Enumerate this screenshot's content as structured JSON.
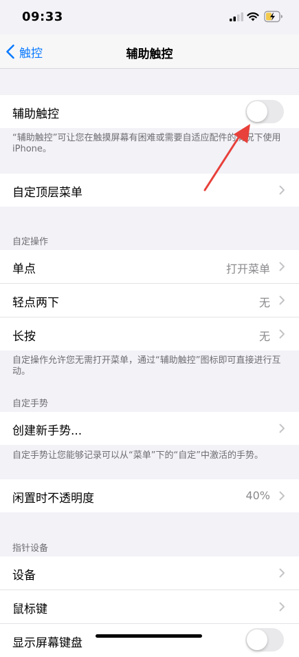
{
  "status_bar": {
    "time": "09:33"
  },
  "nav": {
    "back_label": "触控",
    "title": "辅助触控"
  },
  "main_toggle": {
    "label": "辅助触控",
    "on": false
  },
  "main_footnote": "“辅助触控”可让您在触摸屏幕有困难或需要自适应配件的情况下使用iPhone。",
  "top_menu": {
    "label": "自定顶层菜单"
  },
  "custom_actions": {
    "header": "自定操作",
    "items": [
      {
        "label": "单点",
        "value": "打开菜单"
      },
      {
        "label": "轻点两下",
        "value": "无"
      },
      {
        "label": "长按",
        "value": "无"
      }
    ],
    "footnote": "自定操作允许您无需打开菜单，通过“辅助触控”图标即可直接进行互动。"
  },
  "custom_gestures": {
    "header": "自定手势",
    "create_label": "创建新手势...",
    "footnote": "自定手势让您能够记录可以从“菜单”下的“自定”中激活的手势。"
  },
  "idle_opacity": {
    "label": "闲置时不透明度",
    "value": "40%"
  },
  "pointer_devices": {
    "header": "指针设备",
    "items": [
      {
        "label": "设备"
      },
      {
        "label": "鼠标键"
      }
    ],
    "keyboard_label": "显示屏幕键盘",
    "keyboard_on": false
  },
  "colors": {
    "accent": "#0a7aff",
    "annotation": "#e8403a"
  }
}
